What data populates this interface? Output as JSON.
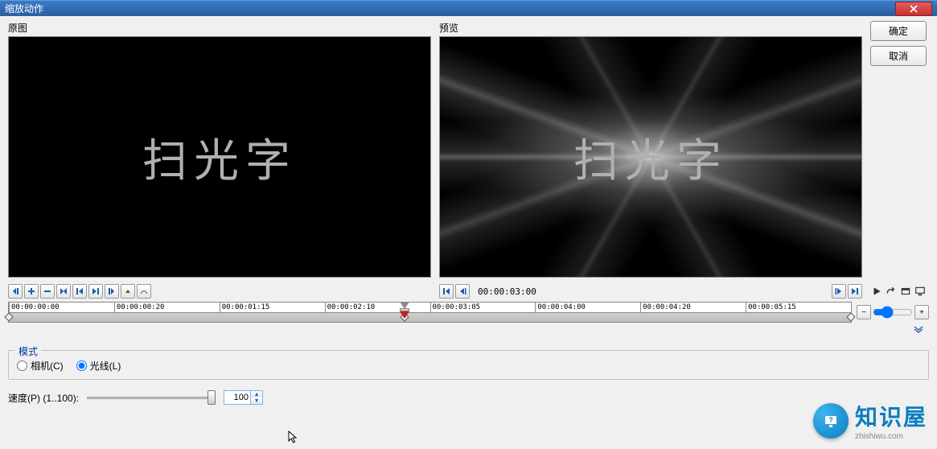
{
  "titlebar": {
    "title": "缩放动作"
  },
  "buttons": {
    "ok": "确定",
    "cancel": "取消"
  },
  "labels": {
    "original": "原图",
    "preview": "预览"
  },
  "preview_text": "扫光字",
  "playback": {
    "time": "00:00:03:00"
  },
  "ruler_ticks": [
    {
      "pct": 0,
      "label": "00:00:00:00"
    },
    {
      "pct": 12.5,
      "label": "00:00:00:20"
    },
    {
      "pct": 25,
      "label": "00:00:01:15"
    },
    {
      "pct": 37.5,
      "label": "00:00:02:10"
    },
    {
      "pct": 50,
      "label": "00:00:03:05"
    },
    {
      "pct": 62.5,
      "label": "00:00:04:00"
    },
    {
      "pct": 75,
      "label": "00:00:04:20"
    },
    {
      "pct": 87.5,
      "label": "00:00:05:15"
    }
  ],
  "keyframes": [
    0,
    47,
    100
  ],
  "playhead_pct": 47,
  "mode": {
    "legend": "模式",
    "camera": "相机(C)",
    "light": "光线(L)",
    "selected": "light"
  },
  "speed": {
    "label": "速度(P) (1..100):",
    "value": "100"
  },
  "watermark": {
    "icon": "?",
    "main": "知识屋",
    "sub": "zhishiwu.com"
  }
}
